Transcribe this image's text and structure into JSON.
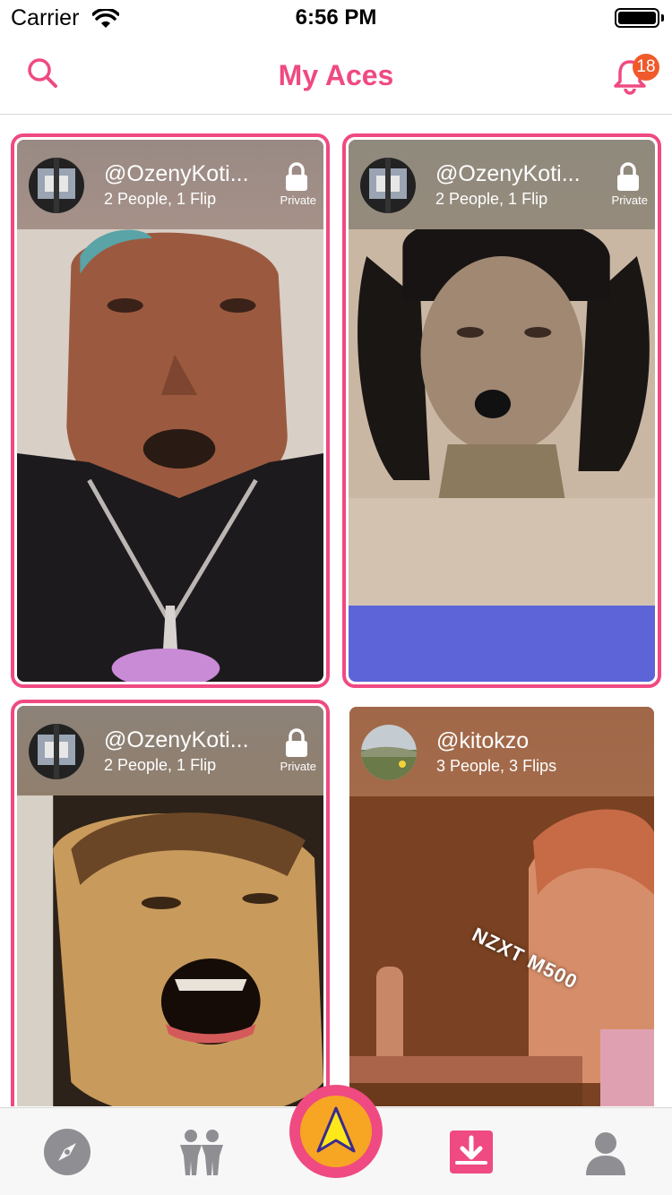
{
  "status_bar": {
    "carrier": "Carrier",
    "time": "6:56 PM"
  },
  "header": {
    "title": "My Aces",
    "notification_count": "18"
  },
  "cards": [
    {
      "username": "@OzenyKoti...",
      "meta": "2 People, 1 Flip",
      "privacy": "Private",
      "highlighted": true
    },
    {
      "username": "@OzenyKoti...",
      "meta": "2 People, 1 Flip",
      "privacy": "Private",
      "highlighted": true
    },
    {
      "username": "@OzenyKoti...",
      "meta": "2 People, 1 Flip",
      "privacy": "Private",
      "highlighted": true
    },
    {
      "username": "@kitokzo",
      "meta": "3 People, 3 Flips",
      "highlighted": false,
      "overlay_text": "NZXT M500"
    }
  ],
  "tab_bar": {
    "tabs": [
      "compass-icon",
      "people-icon",
      "create-ace-icon",
      "inbox-download-icon",
      "profile-icon"
    ],
    "active_tab": "inbox-download-icon"
  },
  "colors": {
    "accent": "#ef4a81",
    "badge": "#f05a2b",
    "center_inner": "#f6a623",
    "arrow": "#ffe81a"
  }
}
